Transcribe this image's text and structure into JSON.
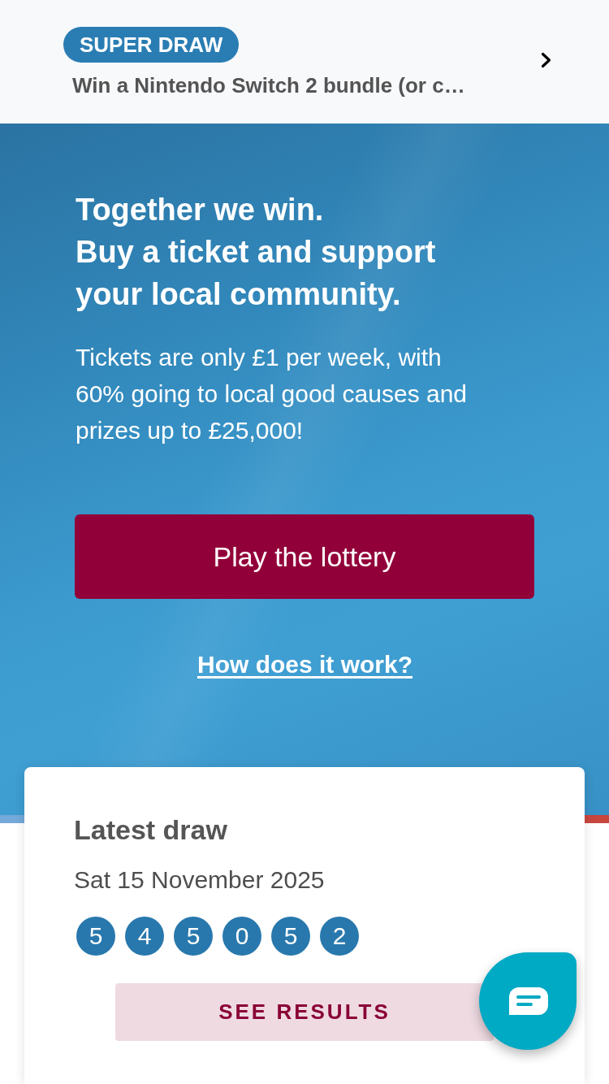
{
  "promo_banner": {
    "badge": "SUPER DRAW",
    "title": "Win a Nintendo Switch 2 bundle (or c…"
  },
  "hero": {
    "headline_lines": [
      "Together we win.",
      "Buy a ticket and support your local community."
    ],
    "body": "Tickets are only £1 per week, with 60% going to local good causes and prizes up to £25,000!",
    "primary_button": "Play the lottery",
    "link": "How does it work?"
  },
  "latest_draw": {
    "title": "Latest draw",
    "date": "Sat 15 November 2025",
    "numbers": [
      "5",
      "4",
      "5",
      "0",
      "5",
      "2"
    ],
    "button": "SEE RESULTS"
  }
}
